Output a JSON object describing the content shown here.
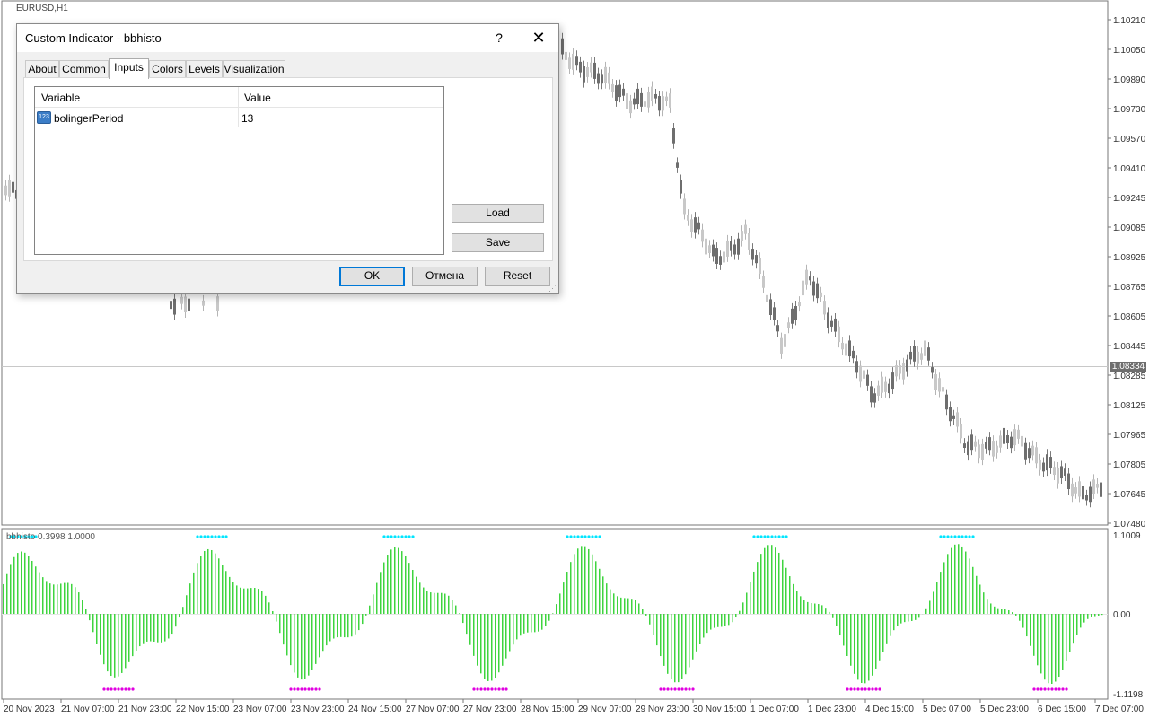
{
  "chart": {
    "symbol": "EURUSD,H1",
    "current_price": "1.08334",
    "price_ticks": [
      "1.10210",
      "1.10050",
      "1.09890",
      "1.09730",
      "1.09570",
      "1.09410",
      "1.09245",
      "1.09085",
      "1.08925",
      "1.08765",
      "1.08605",
      "1.08445",
      "1.08285",
      "1.08125",
      "1.07965",
      "1.07805",
      "1.07645",
      "1.07480"
    ],
    "indicator_label": "bbhisto 0.3998 1.0000",
    "indicator_ticks": [
      "1.1009",
      "0.00",
      "-1.1198"
    ],
    "time_ticks": [
      "20 Nov 2023",
      "21 Nov 07:00",
      "21 Nov 23:00",
      "22 Nov 15:00",
      "23 Nov 07:00",
      "23 Nov 23:00",
      "24 Nov 15:00",
      "27 Nov 07:00",
      "27 Nov 23:00",
      "28 Nov 15:00",
      "29 Nov 07:00",
      "29 Nov 23:00",
      "30 Nov 15:00",
      "1 Dec 07:00",
      "1 Dec 23:00",
      "4 Dec 15:00",
      "5 Dec 07:00",
      "5 Dec 23:00",
      "6 Dec 15:00",
      "7 Dec 07:00"
    ],
    "colors": {
      "candle": "#7a7a7a",
      "histogram": "#3fd43f",
      "dot_upper": "#00e5ff",
      "dot_lower": "#e000e0",
      "price_badge": "#6e6e6e"
    }
  },
  "dialog": {
    "title": "Custom Indicator - bbhisto",
    "help_label": "?",
    "close_label": "✕",
    "tabs": [
      {
        "label": "About",
        "active": false
      },
      {
        "label": "Common",
        "active": false
      },
      {
        "label": "Inputs",
        "active": true
      },
      {
        "label": "Colors",
        "active": false
      },
      {
        "label": "Levels",
        "active": false
      },
      {
        "label": "Visualization",
        "active": false
      }
    ],
    "grid": {
      "headers": [
        "Variable",
        "Value"
      ],
      "rows": [
        {
          "icon": "integer-param-icon",
          "icon_text": "123",
          "variable": "bolingerPeriod",
          "value": "13"
        }
      ]
    },
    "side_buttons": {
      "load": "Load",
      "save": "Save"
    },
    "footer_buttons": {
      "ok": "OK",
      "cancel": "Отмена",
      "reset": "Reset"
    }
  }
}
